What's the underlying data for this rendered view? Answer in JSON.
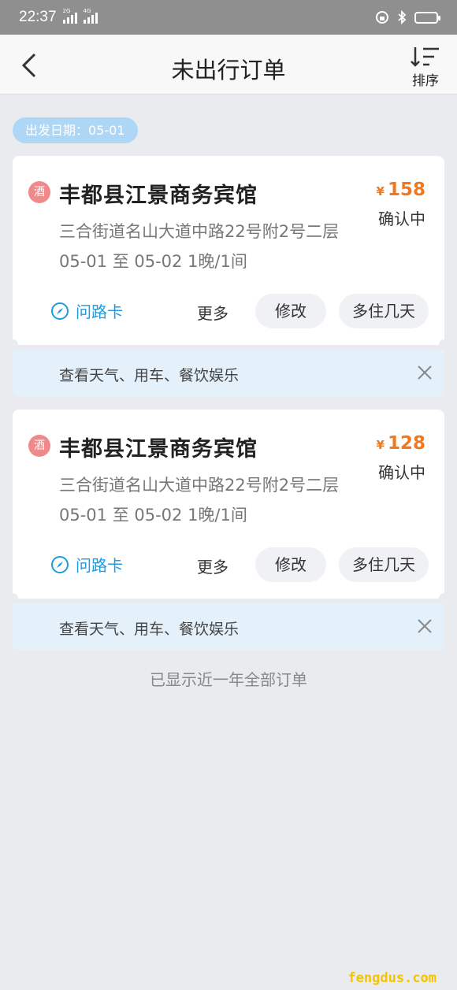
{
  "status_bar": {
    "time": "22:37",
    "sim1": "2G",
    "sim2": "4G"
  },
  "header": {
    "title": "未出行订单",
    "sort_label": "排序"
  },
  "date_chip": "出发日期：05-01",
  "orders": [
    {
      "hotel_name": "丰都县江景商务宾馆",
      "hotel_icon": "酒",
      "price_symbol": "¥",
      "price": "158",
      "status": "确认中",
      "address": "三合街道名山大道中路22号附2号二层",
      "dates": "05-01 至 05-02  1晚/1间",
      "map_card": "问路卡",
      "more": "更多",
      "modify": "修改",
      "extend": "多住几天",
      "banner": "查看天气、用车、餐饮娱乐"
    },
    {
      "hotel_name": "丰都县江景商务宾馆",
      "hotel_icon": "酒",
      "price_symbol": "¥",
      "price": "128",
      "status": "确认中",
      "address": "三合街道名山大道中路22号附2号二层",
      "dates": "05-01 至 05-02  1晚/1间",
      "map_card": "问路卡",
      "more": "更多",
      "modify": "修改",
      "extend": "多住几天",
      "banner": "查看天气、用车、餐饮娱乐"
    }
  ],
  "footer": "已显示近一年全部订单",
  "watermark": "fengdus.com",
  "colors": {
    "accent": "#1f9be0",
    "price": "#f0791f",
    "chip": "#aed7f5",
    "hotel_icon": "#f0898a",
    "banner": "#e4f1fb"
  },
  "icons": [
    "back-arrow-icon",
    "sort-icon",
    "hotel-icon",
    "compass-icon",
    "close-icon",
    "battery-icon",
    "bluetooth-icon",
    "alarm-icon"
  ]
}
